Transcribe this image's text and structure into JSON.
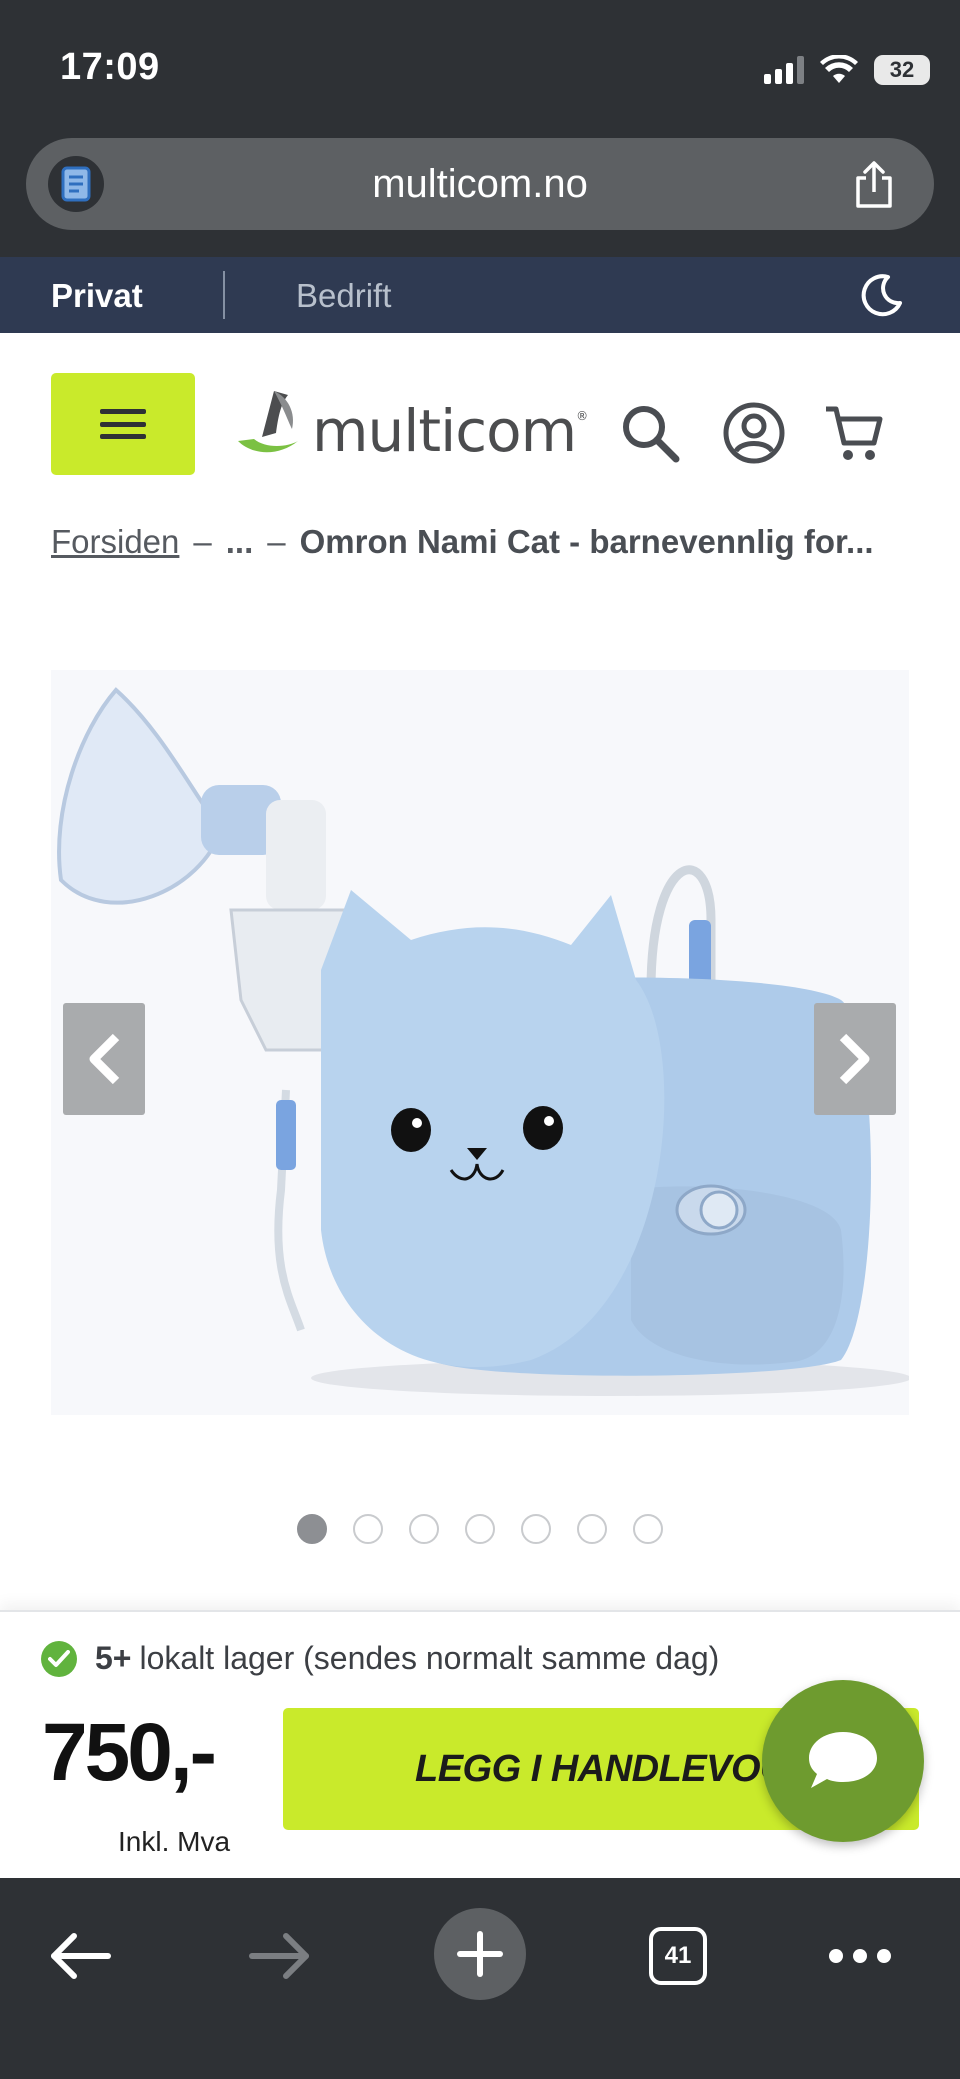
{
  "status_bar": {
    "time": "17:09",
    "battery": "32"
  },
  "browser": {
    "url": "multicom.no",
    "reader_icon": "reader-icon",
    "share_icon": "share-icon",
    "tabs_count": "41"
  },
  "segment_nav": {
    "privat": "Privat",
    "bedrift": "Bedrift",
    "theme_icon": "moon-icon"
  },
  "header": {
    "menu_icon": "hamburger-icon",
    "logo_text": "multicom",
    "logo_mark": "®",
    "search_icon": "search-icon",
    "account_icon": "account-icon",
    "cart_icon": "cart-icon"
  },
  "breadcrumb": {
    "home": "Forsiden",
    "separator": "–",
    "middle": "...",
    "current": "Omron Nami Cat - barnevennlig for..."
  },
  "gallery": {
    "image_alt": "Omron Nami Cat nebulizer",
    "prev_icon": "chevron-left-icon",
    "next_icon": "chevron-right-icon",
    "dot_count": 7,
    "active_index": 0
  },
  "purchase": {
    "stock_count": "5+",
    "stock_text": "lokalt lager (sendes normalt samme dag)",
    "price": "750,-",
    "price_note": "Inkl. Mva",
    "add_to_cart": "LEGG I HANDLEVOGN",
    "chat_icon": "chat-bubble-icon"
  },
  "colors": {
    "accent_lime": "#c9ea2b",
    "nav_navy": "#2f3a52",
    "chat_green": "#6e9b2f",
    "stock_green": "#61b33e"
  }
}
